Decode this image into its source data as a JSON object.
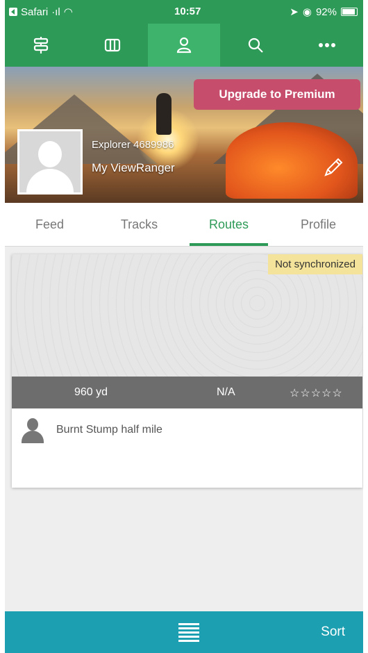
{
  "status_bar": {
    "back_app": "Safari",
    "time": "10:57",
    "battery": "92%"
  },
  "nav": {
    "items": [
      "routes-nav-icon",
      "map-icon",
      "profile-icon",
      "search-icon",
      "more-icon"
    ],
    "active_index": 2,
    "accent": "#2e9a57"
  },
  "hero": {
    "upgrade_label": "Upgrade to Premium",
    "explorer_name": "Explorer 4689986",
    "subtitle": "My ViewRanger"
  },
  "tabs": [
    {
      "label": "Feed"
    },
    {
      "label": "Tracks"
    },
    {
      "label": "Routes"
    },
    {
      "label": "Profile"
    }
  ],
  "active_tab": "Routes",
  "route_card": {
    "sync_status": "Not synchronized",
    "distance": "960 yd",
    "difficulty": "N/A",
    "rating": "☆☆☆☆☆",
    "name": "Burnt Stump half mile"
  },
  "bottom_bar": {
    "sort_label": "Sort",
    "menu_icon": "list-icon",
    "color": "#1b9fb1"
  }
}
